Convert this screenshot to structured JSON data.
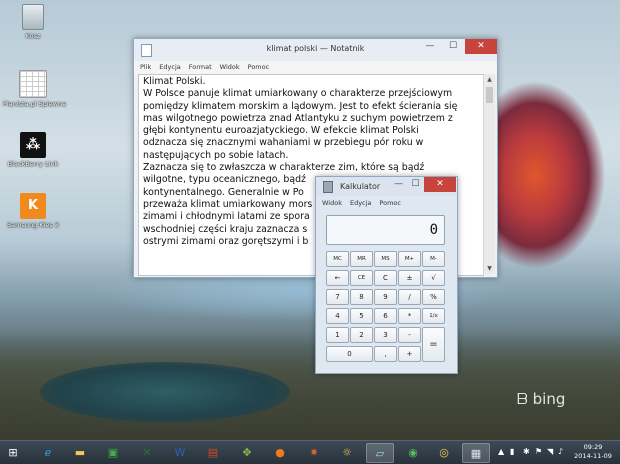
{
  "desktop": {
    "icons": [
      {
        "label": "Kosz"
      },
      {
        "label": "Planista.pl Spiewne"
      },
      {
        "label": "BlackBerry Link"
      },
      {
        "label": "Samsung Kies 3"
      }
    ],
    "watermark": "bing"
  },
  "notepad": {
    "title": "klimat polski — Notatnik",
    "menu": [
      "Plik",
      "Edycja",
      "Format",
      "Widok",
      "Pomoc"
    ],
    "lines": [
      "Klimat Polski.",
      "W Polsce panuje klimat umiarkowany o charakterze przejściowym",
      "pomiędzy klimatem morskim a lądowym. Jest to efekt ścierania się",
      "mas wilgotnego powietrza znad Atlantyku z suchym powietrzem z",
      "głębi kontynentu euroazjatyckiego. W efekcie klimat Polski",
      "odznacza się znacznymi wahaniami w przebiegu pór roku w",
      "następujących po sobie latach.",
      "Zaznacza się to zwłaszcza w charakterze zim, które są bądź",
      "wilgotne, typu oceanicznego, bądź",
      "kontynentalnego. Generalnie w Po",
      "przeważa klimat umiarkowany mors",
      "zimami i chłodnymi latami ze spora                          we",
      "wschodniej części kraju zaznacza s                          z",
      "ostrymi zimami oraz gorętszymi i b"
    ],
    "buttons": {
      "minimize": "—",
      "maximize": "☐",
      "close": "✕"
    }
  },
  "calculator": {
    "title": "Kalkulator",
    "menu": [
      "Widok",
      "Edycja",
      "Pomoc"
    ],
    "display": "0",
    "buttons": {
      "minimize": "—",
      "maximize": "☐",
      "close": "✕"
    },
    "rows": [
      [
        "MC",
        "MR",
        "MS",
        "M+",
        "M-"
      ],
      [
        "←",
        "CE",
        "C",
        "±",
        "√"
      ],
      [
        "7",
        "8",
        "9",
        "/",
        "%"
      ],
      [
        "4",
        "5",
        "6",
        "*",
        "1/x"
      ],
      [
        "1",
        "2",
        "3",
        "-",
        "="
      ],
      [
        "0",
        ",",
        "+"
      ]
    ]
  },
  "taskbar": {
    "clock_time": "09:29",
    "clock_date": "2014-11-09"
  }
}
